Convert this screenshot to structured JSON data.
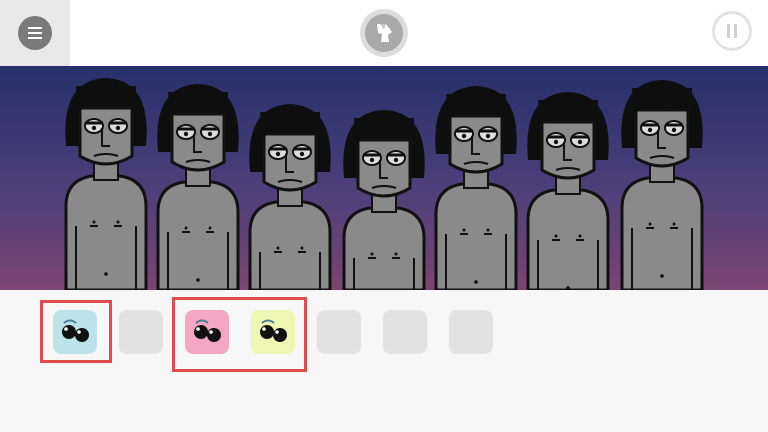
{
  "topbar": {
    "menu_icon": "hamburger-icon",
    "center_icon": "polo-shirt-icon",
    "pause_icon": "pause-icon"
  },
  "stage": {
    "performers": [
      {
        "position": 1
      },
      {
        "position": 2
      },
      {
        "position": 3
      },
      {
        "position": 4
      },
      {
        "position": 5
      },
      {
        "position": 6
      },
      {
        "position": 7
      }
    ]
  },
  "sound_slots": [
    {
      "icon": "sunglasses-icon",
      "color": "#bde3ea",
      "highlighted": true
    },
    {
      "icon": "",
      "color": "#e2e2e2",
      "highlighted": false
    },
    {
      "icon": "sunglasses-icon",
      "color": "#f4a6c2",
      "highlighted": true
    },
    {
      "icon": "sunglasses-icon",
      "color": "#eef7b4",
      "highlighted": true
    },
    {
      "icon": "",
      "color": "#e2e2e2",
      "highlighted": false
    },
    {
      "icon": "",
      "color": "#e2e2e2",
      "highlighted": false
    },
    {
      "icon": "",
      "color": "#e2e2e2",
      "highlighted": false
    }
  ],
  "colors": {
    "highlight": "#e24b4b",
    "stage_top": "#25306a",
    "stage_bottom": "#7c4473"
  }
}
